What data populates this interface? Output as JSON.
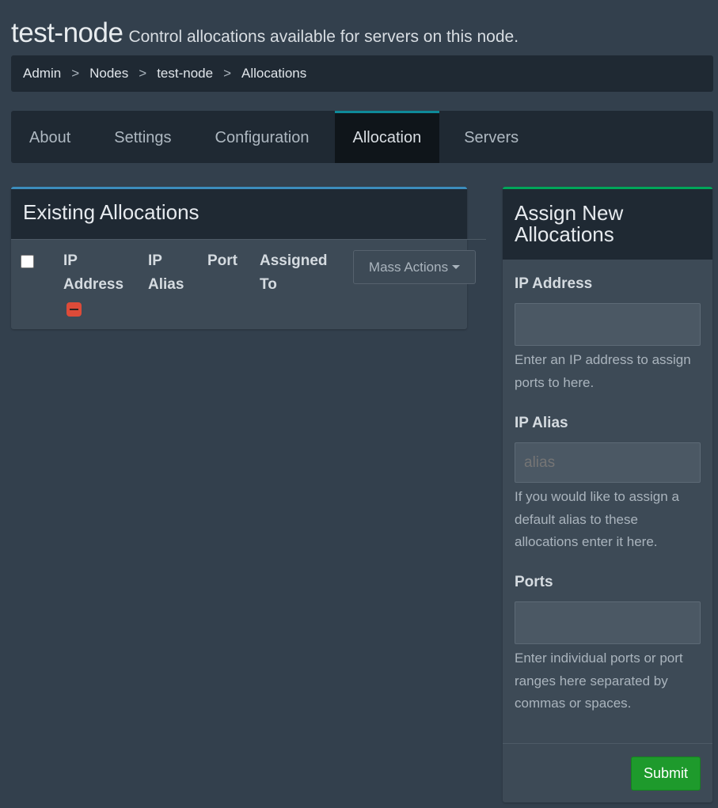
{
  "page": {
    "title": "test-node",
    "subtitle": "Control allocations available for servers on this node."
  },
  "breadcrumb": [
    "Admin",
    "Nodes",
    "test-node",
    "Allocations"
  ],
  "tabs": [
    {
      "label": "About",
      "active": false
    },
    {
      "label": "Settings",
      "active": false
    },
    {
      "label": "Configuration",
      "active": false
    },
    {
      "label": "Allocation",
      "active": true
    },
    {
      "label": "Servers",
      "active": false
    }
  ],
  "existing": {
    "title": "Existing Allocations",
    "columns": {
      "ip_address": [
        "IP",
        "Address"
      ],
      "ip_alias": [
        "IP",
        "Alias"
      ],
      "port": "Port",
      "assigned_to": [
        "Assigned",
        "To"
      ]
    },
    "mass_actions_label": "Mass Actions",
    "rows": []
  },
  "assign": {
    "title": "Assign New Allocations",
    "ip_address": {
      "label": "IP Address",
      "value": "",
      "help": "Enter an IP address to assign ports to here."
    },
    "ip_alias": {
      "label": "IP Alias",
      "placeholder": "alias",
      "value": "",
      "help": "If you would like to assign a default alias to these allocations enter it here."
    },
    "ports": {
      "label": "Ports",
      "value": "",
      "help": "Enter individual ports or port ranges here separated by commas or spaces."
    },
    "submit_label": "Submit"
  },
  "colors": {
    "background": "#33404d",
    "panel": "#1f2933",
    "active_tab_accent": "#0e8a99",
    "existing_box_accent": "#3c8dbc",
    "assign_box_accent": "#00a65a",
    "submit": "#1e9a2c",
    "danger": "#dd4b39"
  },
  "icons": [
    "minus-icon",
    "caret-down-icon"
  ]
}
